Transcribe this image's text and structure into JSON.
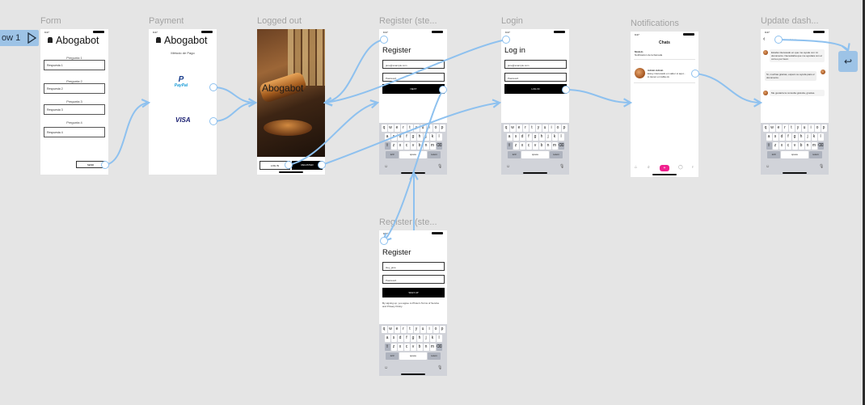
{
  "flow": {
    "label": "ow 1"
  },
  "frames": {
    "form": {
      "label": "Form",
      "time": "9:27",
      "brand": "Abogabot",
      "questions": [
        {
          "q": "Pregunta 1",
          "a": "Respuesta 1"
        },
        {
          "q": "Pregunta 2",
          "a": "Respuesta 2"
        },
        {
          "q": "Pregunta 3",
          "a": "Respuesta 3"
        },
        {
          "q": "Pregunta 4",
          "a": "Respuesta 4"
        }
      ],
      "submit": "SEND"
    },
    "payment": {
      "label": "Payment",
      "time": "9:27",
      "brand": "Abogabot",
      "subtitle": "Método de Pago",
      "paypal_p": "P",
      "paypal_text": "PayPal",
      "visa": "VISA"
    },
    "logged_out": {
      "label": "Logged out",
      "brand": "Abogabot",
      "login_btn": "LOG IN",
      "register_btn": "REGISTER"
    },
    "register1": {
      "label": "Register (ste...",
      "time": "9:27",
      "title": "Register",
      "email": "jane@example.com",
      "password": "Password",
      "button": "NEXT"
    },
    "login": {
      "label": "Login",
      "time": "9:27",
      "title": "Log in",
      "email": "jane@example.com",
      "password": "Password",
      "button": "LOG IN"
    },
    "notifications": {
      "label": "Notifications",
      "time": "9:27",
      "title": "Chats",
      "item1_title": "Modelo",
      "item1_body": "Notificación de la llamada",
      "item2_title": "Admin Admin",
      "item2_body": "Estoy interesado en saber si aquí...",
      "item2_body2": "lo tienen en tabla ok"
    },
    "update": {
      "label": "Update dash...",
      "time": "9:27",
      "header": "Admin",
      "msg1": "Estaba interesado en que me ayude con mi documento. Necesitaba que me ayudara con el correo por favor.",
      "msg2": "Sí, muchas gracias, espero su ayuda para el documento.",
      "msg3": "Me gustaría la consulta gratuita, gracias."
    },
    "register2": {
      "label": "Register (ste...",
      "time": "9:27",
      "title": "Register",
      "name": "Hey_jane",
      "password": "Password",
      "button": "SIGN UP",
      "terms": "By signing up, you agree to Photo's Terms of Service and Privacy Policy."
    }
  },
  "keyboard": {
    "row1": [
      "q",
      "w",
      "e",
      "r",
      "t",
      "y",
      "u",
      "i",
      "o",
      "p"
    ],
    "row2": [
      "a",
      "s",
      "d",
      "f",
      "g",
      "h",
      "j",
      "k",
      "l"
    ],
    "row3": [
      "z",
      "x",
      "c",
      "v",
      "b",
      "n",
      "m"
    ],
    "shift": "⇧",
    "del": "⌫",
    "num": "123",
    "space": "space",
    "ret": "return",
    "emoji": "☺",
    "mic": "🎙"
  },
  "icons": {
    "play": "play-icon",
    "back": "back-arrow-icon",
    "back_glyph": "↩"
  },
  "colors": {
    "canvas": "#e5e5e5",
    "wire": "#8ec1ef",
    "flow_tag": "#9dc3e6",
    "fab": "#f0208e"
  }
}
